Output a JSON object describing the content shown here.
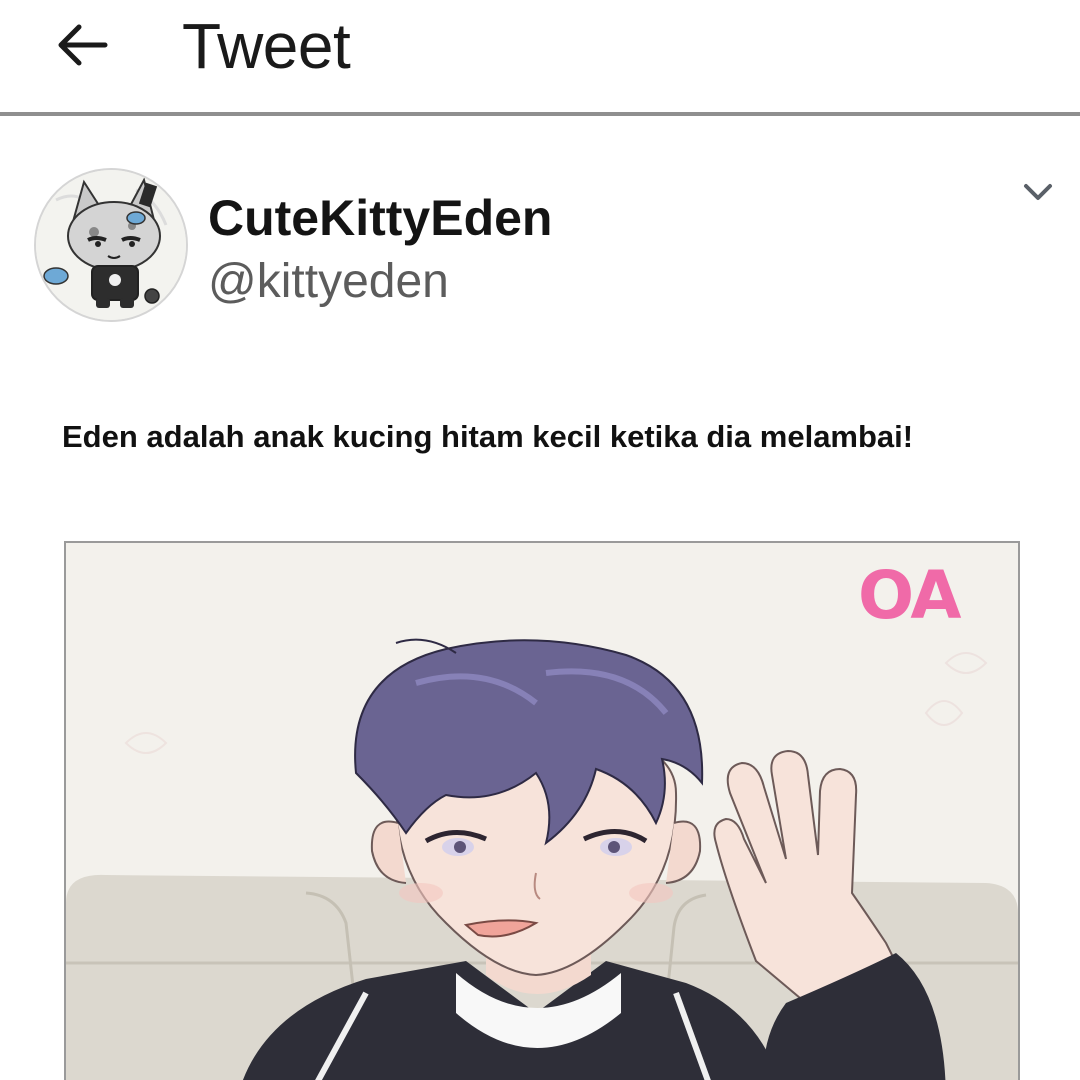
{
  "header": {
    "title": "Tweet",
    "back_icon": "arrow-left-icon"
  },
  "tweet": {
    "author": {
      "display_name": "CuteKittyEden",
      "handle": "@kittyeden",
      "avatar": "cat-character-avatar"
    },
    "menu_icon": "chevron-down-icon",
    "text": "Eden adalah anak kucing hitam kecil ketika dia melambai!",
    "media": {
      "watermark": "OA",
      "subject": "anime-boy-waving"
    }
  },
  "colors": {
    "divider": "#8f8f8f",
    "handle": "#5c5c5c",
    "watermark": "#f06aa8",
    "hair": "#6a6492"
  }
}
